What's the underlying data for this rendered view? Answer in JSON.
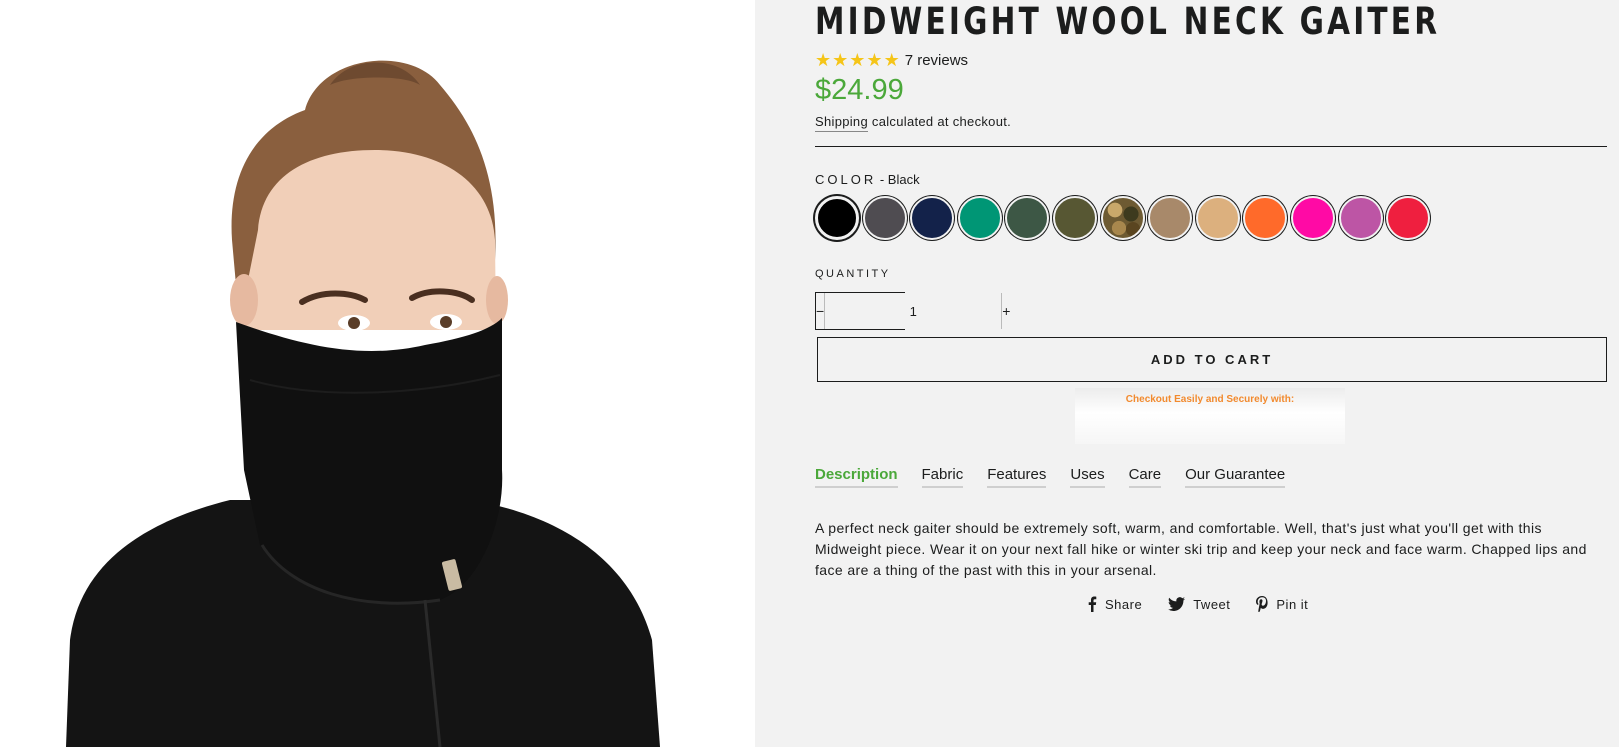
{
  "product": {
    "title": "MIDWEIGHT WOOL NECK GAITER",
    "rating_stars": 5,
    "reviews_label": "7 reviews",
    "price": "$24.99",
    "shipping_link": "Shipping",
    "shipping_rest": " calculated at checkout."
  },
  "color": {
    "label": "COLOR",
    "separator": " - ",
    "selected": "Black",
    "swatches": [
      {
        "name": "Black",
        "hex": "#000000"
      },
      {
        "name": "Charcoal",
        "hex": "#4f4c51"
      },
      {
        "name": "Navy",
        "hex": "#13224a"
      },
      {
        "name": "Teal",
        "hex": "#009675"
      },
      {
        "name": "Forest",
        "hex": "#3d5745"
      },
      {
        "name": "Olive",
        "hex": "#575733"
      },
      {
        "name": "Camo",
        "hex": "#6d5a32"
      },
      {
        "name": "Tan",
        "hex": "#a8896a"
      },
      {
        "name": "Sand",
        "hex": "#dcb07e"
      },
      {
        "name": "Orange",
        "hex": "#ff6a2a"
      },
      {
        "name": "Pink",
        "hex": "#ff0aa5"
      },
      {
        "name": "Orchid",
        "hex": "#bd55a5"
      },
      {
        "name": "Red",
        "hex": "#ef1f3f"
      }
    ]
  },
  "quantity": {
    "label": "QUANTITY",
    "minus": "−",
    "value": "1",
    "plus": "+"
  },
  "add_to_cart": "ADD TO CART",
  "checkout_banner": "Checkout Easily and Securely with:",
  "tabs": [
    "Description",
    "Fabric",
    "Features",
    "Uses",
    "Care",
    "Our Guarantee"
  ],
  "active_tab": "Description",
  "description": "A perfect neck gaiter should be extremely soft, warm, and comfortable. Well, that's just what you'll get with this Midweight piece. Wear it on your next fall hike or winter ski trip and keep your neck and face warm. Chapped lips and face are a thing of the past with this in your arsenal.",
  "social": {
    "share": "Share",
    "tweet": "Tweet",
    "pin": "Pin it"
  },
  "colors": {
    "accent_green": "#4ba83a",
    "star_gold": "#f5c518",
    "panel_bg": "#f2f2f2"
  }
}
